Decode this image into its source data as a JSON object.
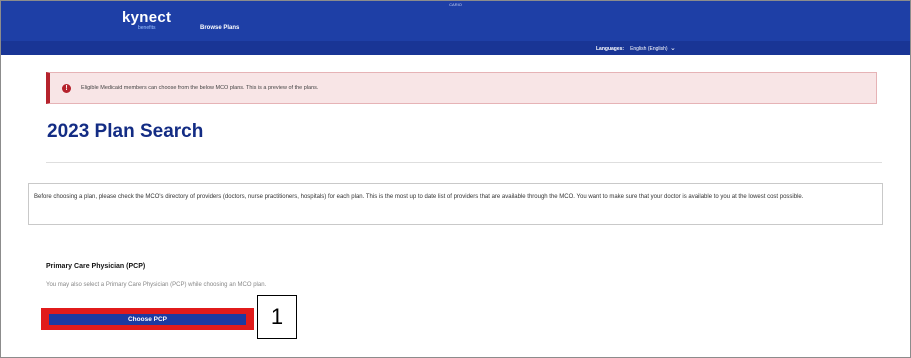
{
  "header": {
    "env_tag": "CARIO",
    "logo_main": "kynect",
    "logo_sub": "benefits",
    "nav_browse_plans": "Browse Plans"
  },
  "language_bar": {
    "label": "Languages:",
    "value": "English (English)"
  },
  "alert": {
    "icon": "alert-circle-icon",
    "text": "Eligible Medicaid members can choose from the below MCO plans. This is a preview of the plans."
  },
  "page_title": "2023 Plan Search",
  "info_text": "Before choosing a plan, please check the MCO's directory of providers (doctors, nurse practitioners, hospitals) for each plan. This is the most up to date list of providers that are available through the MCO. You want to make sure that your doctor is available to you at the lowest cost possible.",
  "pcp": {
    "heading": "Primary Care Physician (PCP)",
    "note": "You may also select a Primary Care Physician (PCP) while choosing an MCO plan.",
    "button_label": "Choose PCP"
  },
  "annotation": {
    "step_number": "1",
    "highlight_color": "#e11b1b"
  },
  "colors": {
    "header_blue": "#1e3fa6",
    "title_blue": "#132c84",
    "alert_red": "#b5222c"
  }
}
